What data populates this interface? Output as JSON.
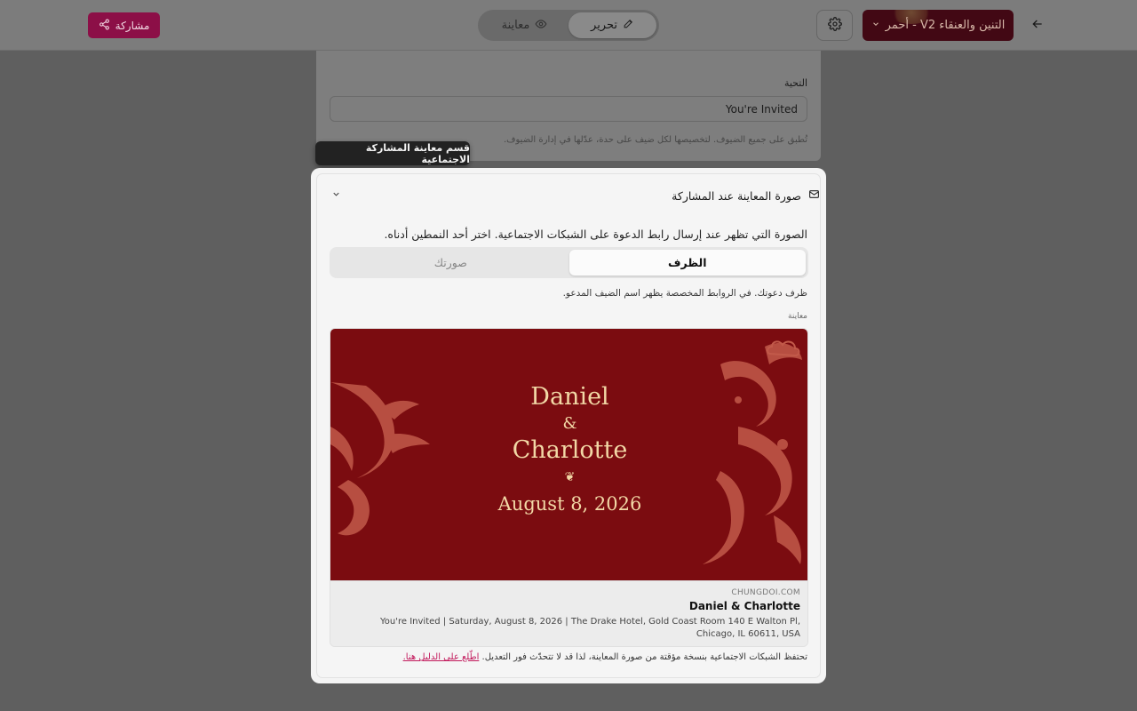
{
  "topbar": {
    "share_label": "مشاركة",
    "mode_edit": "تحرير",
    "mode_preview": "معاينة",
    "theme_label": "التنين والعنقاء V2 - أحمر",
    "colors": {
      "share": "#8c0f47",
      "theme": "#420814"
    }
  },
  "form_card": {
    "greeting_label": "التحية",
    "greeting_value": "You're Invited",
    "greeting_hint": "تُطبق على جميع الضيوف. لتخصيصها لكل ضيف على حدة، عدّلها في إدارة الضيوف."
  },
  "tooltip": {
    "text": "قسم معاينة المشاركة الاجتماعية"
  },
  "section": {
    "title": "صورة المعاينة عند المشاركة",
    "description": "الصورة التي تظهر عند إرسال رابط الدعوة على الشبكات الاجتماعية. اختر أحد النمطين أدناه.",
    "tabs": [
      {
        "label": "الظرف",
        "active": true
      },
      {
        "label": "صورتك",
        "active": false
      }
    ],
    "tab_hint": "ظرف دعوتك. في الروابط المخصصة يظهر اسم الضيف المدعو.",
    "preview_label": "معاينة",
    "invite": {
      "name1": "Daniel",
      "amp": "&",
      "name2": "Charlotte",
      "ornament": "❦",
      "date": "August 8, 2026",
      "bg_color": "#7b0c10",
      "text_color": "#f2d8a6"
    },
    "link_meta": {
      "domain": "CHUNGDOI.COM",
      "title": "Daniel & Charlotte",
      "description": "You're Invited | Saturday, August 8, 2026 | The Drake Hotel, Gold Coast Room 140 E Walton Pl, Chicago, IL 60611, USA"
    },
    "footer_text": "تحتفظ الشبكات الاجتماعية بنسخة مؤقتة من صورة المعاينة، لذا قد لا تتحدّث فور التعديل.",
    "footer_link": "اطّلع على الدليل هنا."
  }
}
